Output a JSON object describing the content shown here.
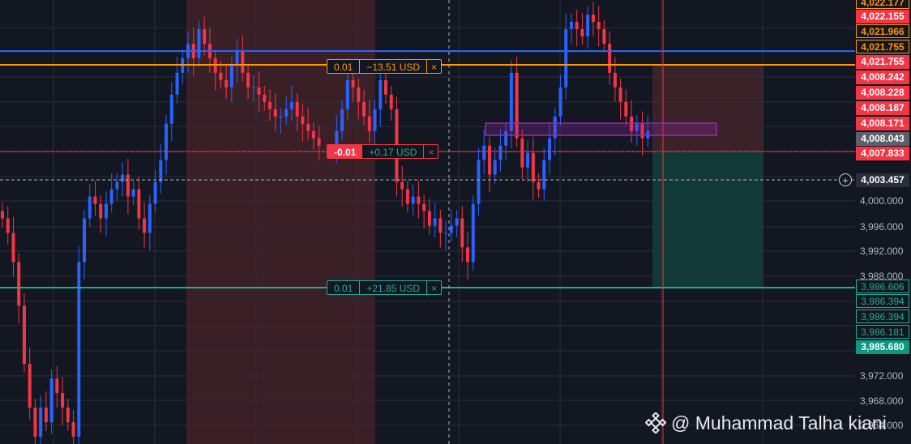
{
  "price_axis": {
    "ticks": [
      "4,000.000",
      "3,996.000",
      "3,992.000",
      "3,988.000",
      "3,972.000",
      "3,968.000",
      "3,964.000"
    ],
    "labels": [
      {
        "text": "4,022.177",
        "style": "orange"
      },
      {
        "text": "4,022.155",
        "style": "solid-red"
      },
      {
        "text": "4,021.966",
        "style": "orange"
      },
      {
        "text": "4,021.755",
        "style": "orange"
      },
      {
        "text": "4,021.755",
        "style": "solid-red"
      },
      {
        "text": "4,008.242",
        "style": "solid-red"
      },
      {
        "text": "4,008.228",
        "style": "solid-red"
      },
      {
        "text": "4,008.187",
        "style": "solid-red"
      },
      {
        "text": "4,008.171",
        "style": "solid-red"
      },
      {
        "text": "4,008.043",
        "style": "gray"
      },
      {
        "text": "4,007.833",
        "style": "solid-red"
      },
      {
        "text": "4,003.457",
        "style": "dark"
      },
      {
        "text": "3,986.606",
        "style": "teal-outline"
      },
      {
        "text": "3,986.394",
        "style": "teal-outline"
      },
      {
        "text": "3,986.394",
        "style": "teal-outline"
      },
      {
        "text": "3,986.181",
        "style": "teal-outline"
      },
      {
        "text": "3,985.680",
        "style": "teal"
      }
    ]
  },
  "orders": {
    "stop_loss": {
      "qty": "0.01",
      "pnl": "−13.51 USD",
      "close": "×"
    },
    "position": {
      "qty": "-0.01",
      "pnl": "+0.17 USD",
      "close": "×"
    },
    "take_profit": {
      "qty": "0.01",
      "pnl": "+21.85 USD",
      "close": "×"
    }
  },
  "crosshair_button": "+",
  "watermark": {
    "logo": "binance-logo",
    "text": "@ Muhammad Talha kiani"
  },
  "colors": {
    "background": "#131722",
    "bull": "#2962ff",
    "bear": "#f23645",
    "stop_line": "#ff9800",
    "blue_line": "#2962ff",
    "target_line": "#22ab94",
    "zone_red": "#3a1f27",
    "zone_green": "#0f3a36",
    "rect_purple": "#9c27b0"
  },
  "chart_data": {
    "type": "candlestick",
    "symbol_shown": false,
    "y_range": [
      3963,
      4024
    ],
    "price_lines": [
      4020.2,
      4019.3,
      4008.0,
      4003.457,
      3986.4
    ],
    "candles_close": [
      3994,
      3992,
      3988,
      3982,
      3974,
      3968,
      3964,
      3968,
      3966,
      3972,
      3970,
      3968,
      3966,
      3964,
      3988,
      3994,
      3997,
      3996,
      3994,
      3996,
      3998,
      3999,
      4000,
      3997,
      3998,
      3994,
      3992,
      3996,
      3999,
      4002,
      4007,
      4011,
      4014,
      4016,
      4018,
      4016,
      4020,
      4018,
      4016,
      4014,
      4013,
      4012,
      4015,
      4017,
      4014,
      4012,
      4012,
      4011,
      4010,
      4009,
      4008,
      4008,
      4009,
      4010,
      4008,
      4007,
      4006,
      4005,
      4004,
      4006,
      4009,
      4013,
      4012,
      4010,
      4008,
      4006,
      4009,
      4013,
      4011,
      4009,
      3999,
      3998,
      3996,
      3997,
      3996,
      3995,
      3993,
      3994,
      3992,
      3992,
      3993,
      3994,
      3990,
      3988,
      3996,
      4002,
      4004,
      4000,
      4002,
      4004,
      4006,
      4014,
      4005,
      4001,
      4003,
      3999,
      3998,
      4002,
      4005,
      4008,
      4012,
      4020,
      4021,
      4020,
      4019,
      4022,
      4021,
      4020,
      4018,
      4014,
      4012,
      4010,
      4008,
      4006,
      4007,
      4005,
      4006
    ]
  }
}
